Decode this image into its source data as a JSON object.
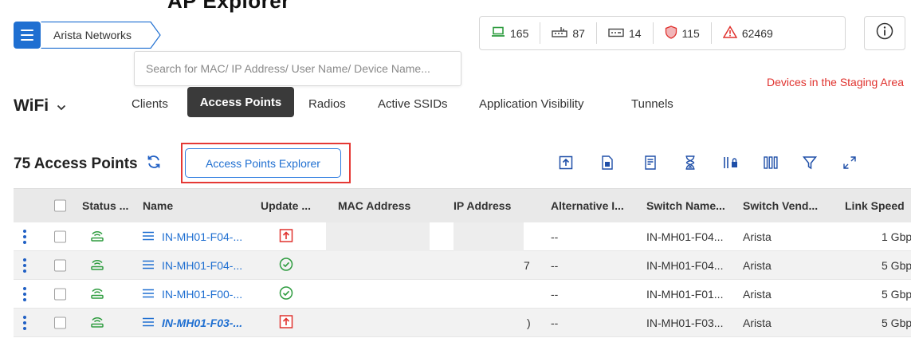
{
  "header": {
    "cut_heading": "AP Explorer",
    "breadcrumb": "Arista Networks",
    "search_placeholder": "Search for MAC/ IP Address/ User Name/ Device Name...",
    "staging_link": "Devices in the Staging Area"
  },
  "stats": {
    "clients": "165",
    "switches": "87",
    "servers": "14",
    "wips": "115",
    "alerts": "62469"
  },
  "nav": {
    "wifi_label": "WiFi",
    "tabs": [
      "Clients",
      "Access Points",
      "Radios",
      "Active SSIDs",
      "Application Visibility",
      "Tunnels"
    ]
  },
  "toolbar": {
    "count_label": "75 Access Points",
    "explorer_button": "Access Points Explorer"
  },
  "table": {
    "columns": [
      "Status ...",
      "Name",
      "Update ...",
      "MAC Address",
      "IP Address",
      "Alternative I...",
      "Switch Name...",
      "Switch Vend...",
      "Link Speed"
    ],
    "rows": [
      {
        "name": "IN-MH01-F04-...",
        "update": "upgrade",
        "alt": "--",
        "switch": "IN-MH01-F04...",
        "vendor": "Arista",
        "speed": "1 Gbp",
        "ip_frag": ""
      },
      {
        "name": "IN-MH01-F04-...",
        "update": "ok",
        "alt": "--",
        "switch": "IN-MH01-F04...",
        "vendor": "Arista",
        "speed": "5 Gbp",
        "ip_frag": "7"
      },
      {
        "name": "IN-MH01-F00-...",
        "update": "ok",
        "alt": "--",
        "switch": "IN-MH01-F01...",
        "vendor": "Arista",
        "speed": "5 Gbp",
        "ip_frag": ""
      },
      {
        "name": "IN-MH01-F03-...",
        "update": "upgrade",
        "alt": "--",
        "switch": "IN-MH01-F03...",
        "vendor": "Arista",
        "speed": "5 Gbp",
        "ip_frag": ")"
      }
    ]
  },
  "colors": {
    "accent": "#1f6fd1",
    "highlight": "#e53935",
    "alert": "#e0322e",
    "ok": "#2e9c3f"
  }
}
